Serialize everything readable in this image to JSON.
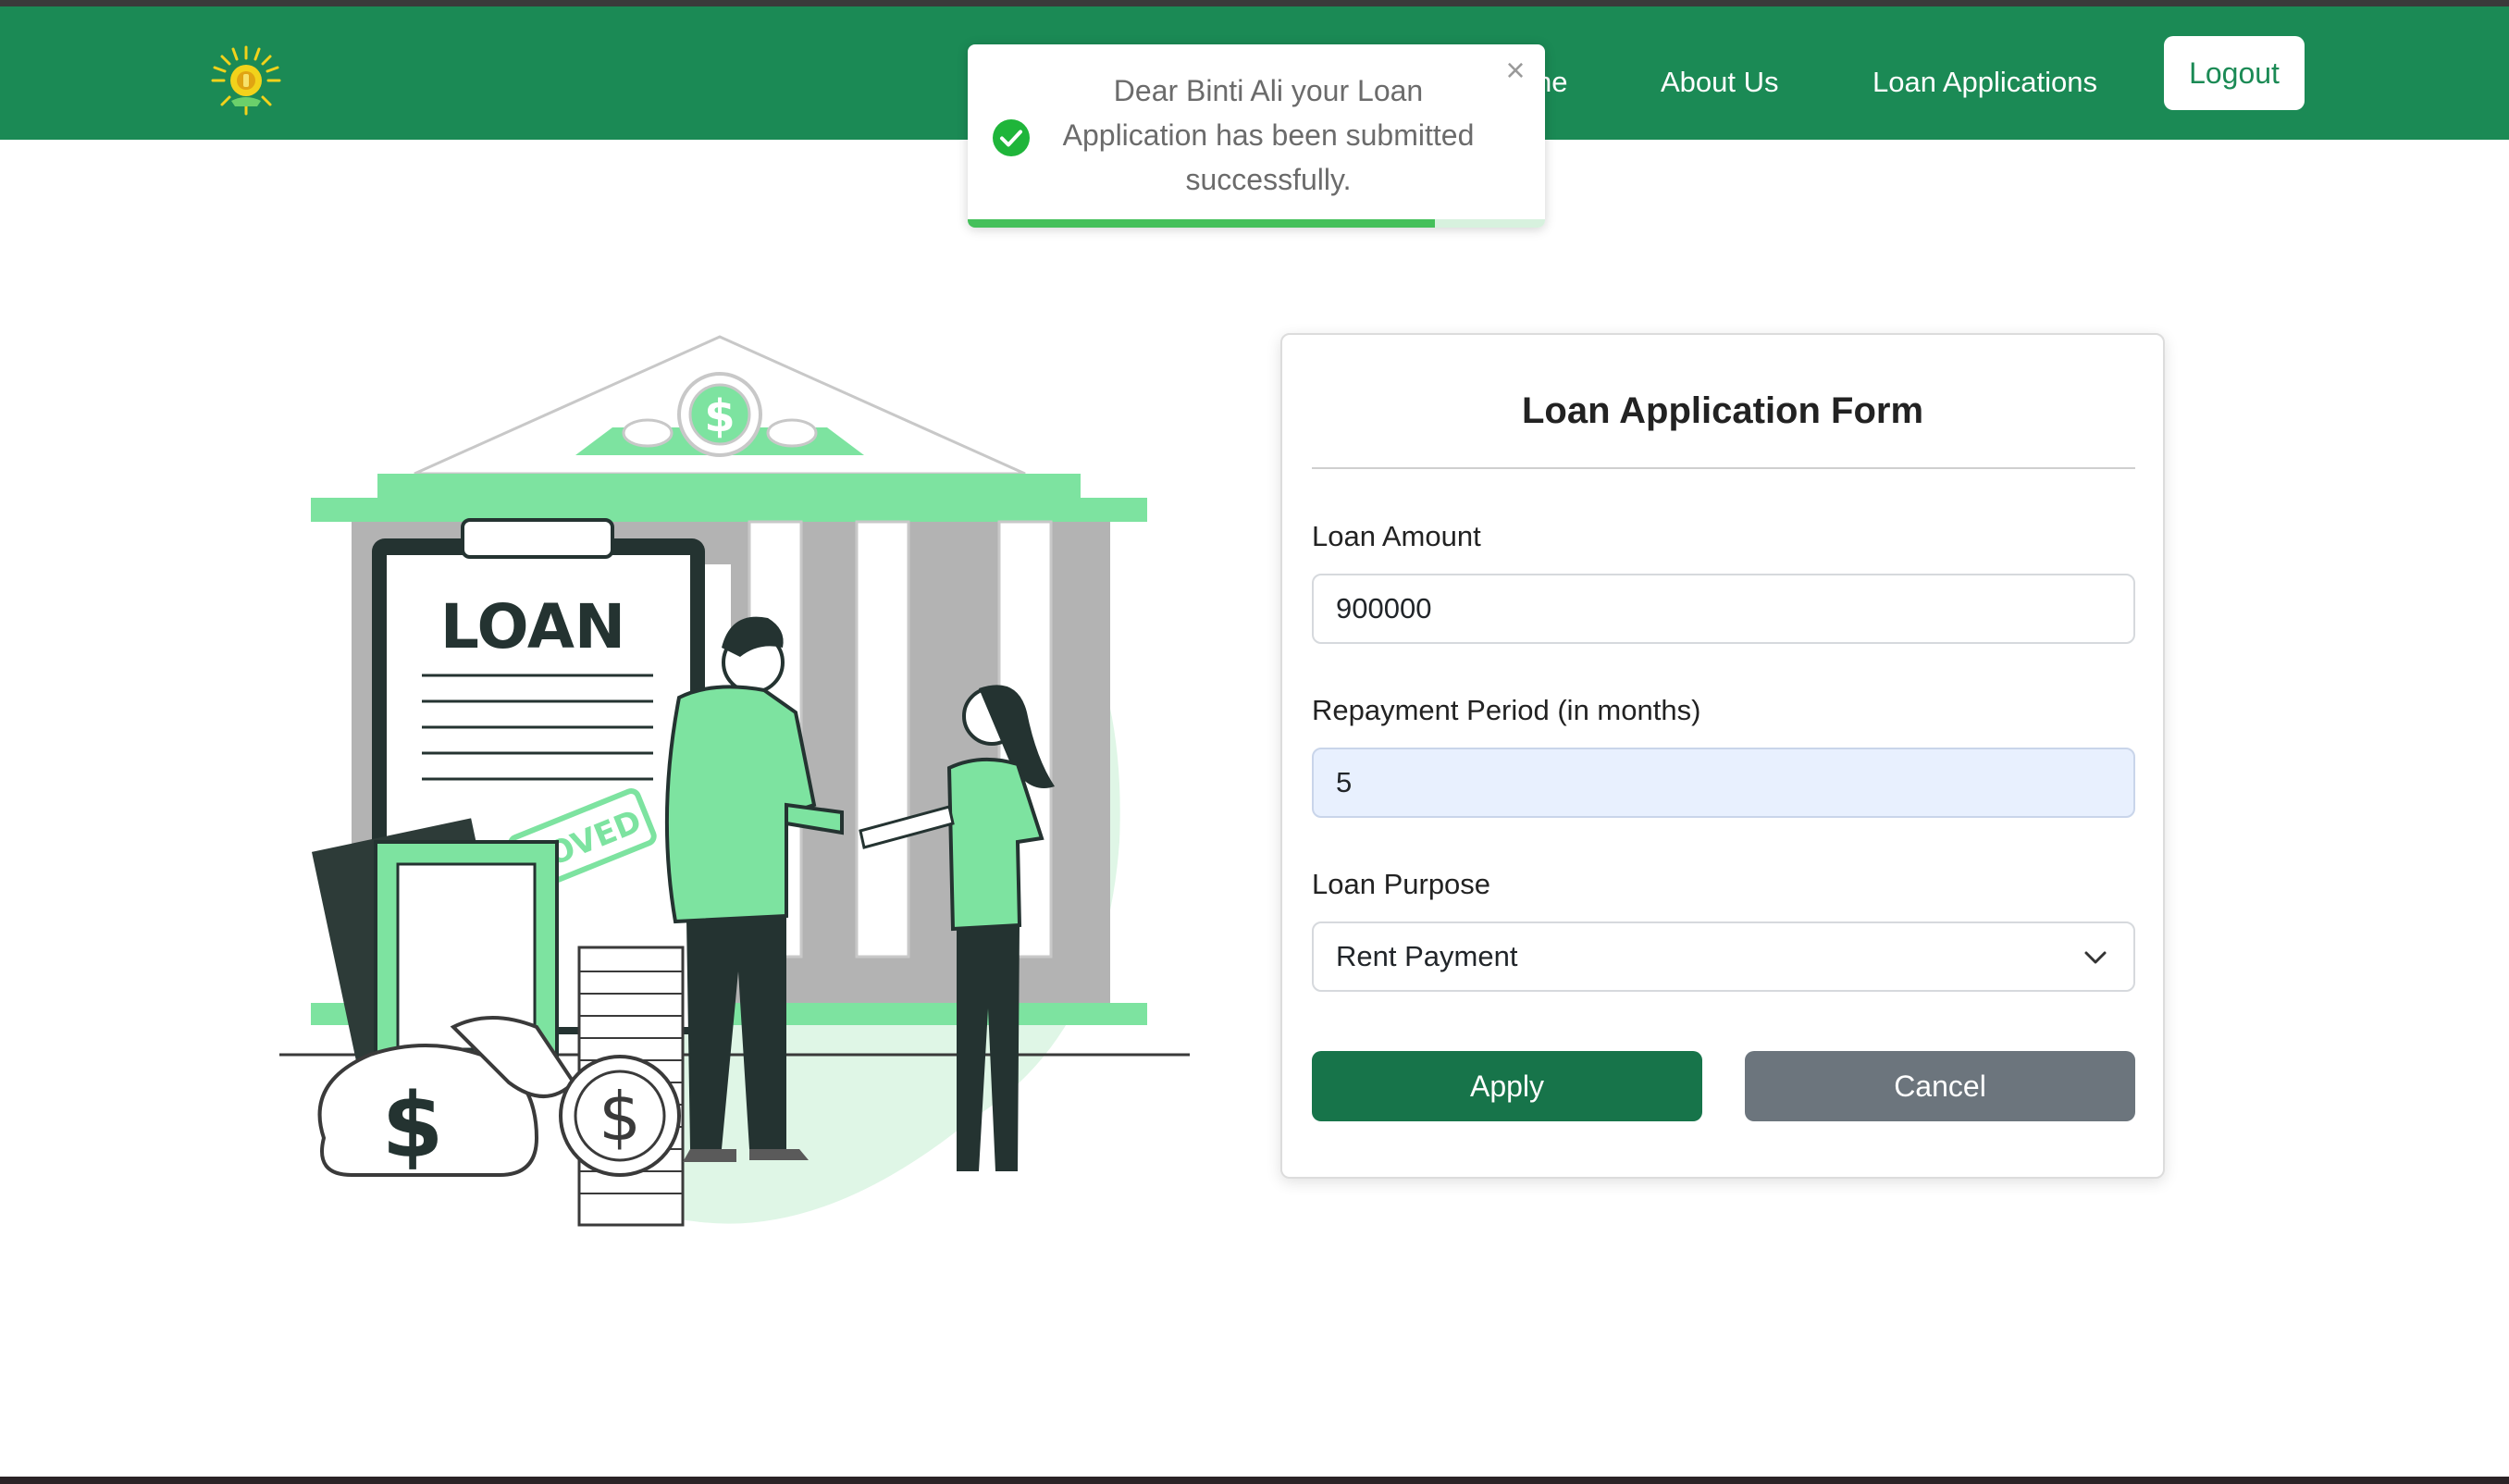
{
  "colors": {
    "navbar": "#1b8a55",
    "primary_button": "#17744a",
    "secondary_button": "#6c757d",
    "illustration_accent": "#7de3a0",
    "success": "#44c05a"
  },
  "navbar": {
    "logo_icon": "sun-coin-logo-icon",
    "links": [
      {
        "label": "ne"
      },
      {
        "label": "About Us"
      },
      {
        "label": "Loan Applications"
      }
    ],
    "logout_label": "Logout"
  },
  "toast": {
    "icon": "check-circle-icon",
    "message": "Dear Binti Ali your Loan Application has been submitted successfully.",
    "close_icon": "close-icon",
    "progress": 0.81
  },
  "illustration": {
    "sign_text": "LOAN",
    "stamp_text": "ROVED",
    "currency_symbol": "$"
  },
  "form": {
    "title": "Loan Application Form",
    "amount_label": "Loan Amount",
    "amount_value": "900000",
    "period_label": "Repayment Period (in months)",
    "period_value": "5",
    "purpose_label": "Loan Purpose",
    "purpose_value": "Rent Payment",
    "apply_label": "Apply",
    "cancel_label": "Cancel"
  }
}
